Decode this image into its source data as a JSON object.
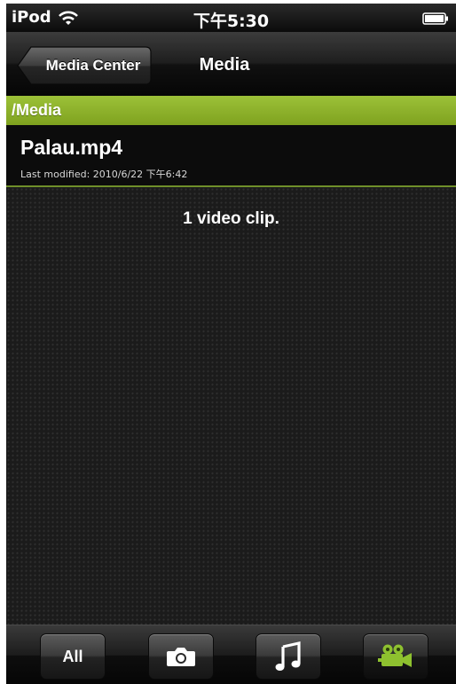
{
  "status_bar": {
    "carrier": "iPod",
    "time": "下午5:30",
    "wifi_icon": "wifi-icon",
    "battery_icon": "battery-icon"
  },
  "nav": {
    "back_label": "Media Center",
    "title": "Media"
  },
  "path": {
    "label": "/Media"
  },
  "files": [
    {
      "name": "Palau.mp4",
      "meta": "Last modified: 2010/6/22 下午6:42"
    }
  ],
  "content": {
    "summary": "1 video clip."
  },
  "tabs": [
    {
      "label": "All",
      "icon": "",
      "active": false
    },
    {
      "label": "",
      "icon": "camera-icon",
      "active": false
    },
    {
      "label": "",
      "icon": "music-note-icon",
      "active": false
    },
    {
      "label": "",
      "icon": "video-camera-icon",
      "active": true
    }
  ],
  "colors": {
    "accent_green": "#8db42c",
    "background": "#1b1b1b"
  }
}
